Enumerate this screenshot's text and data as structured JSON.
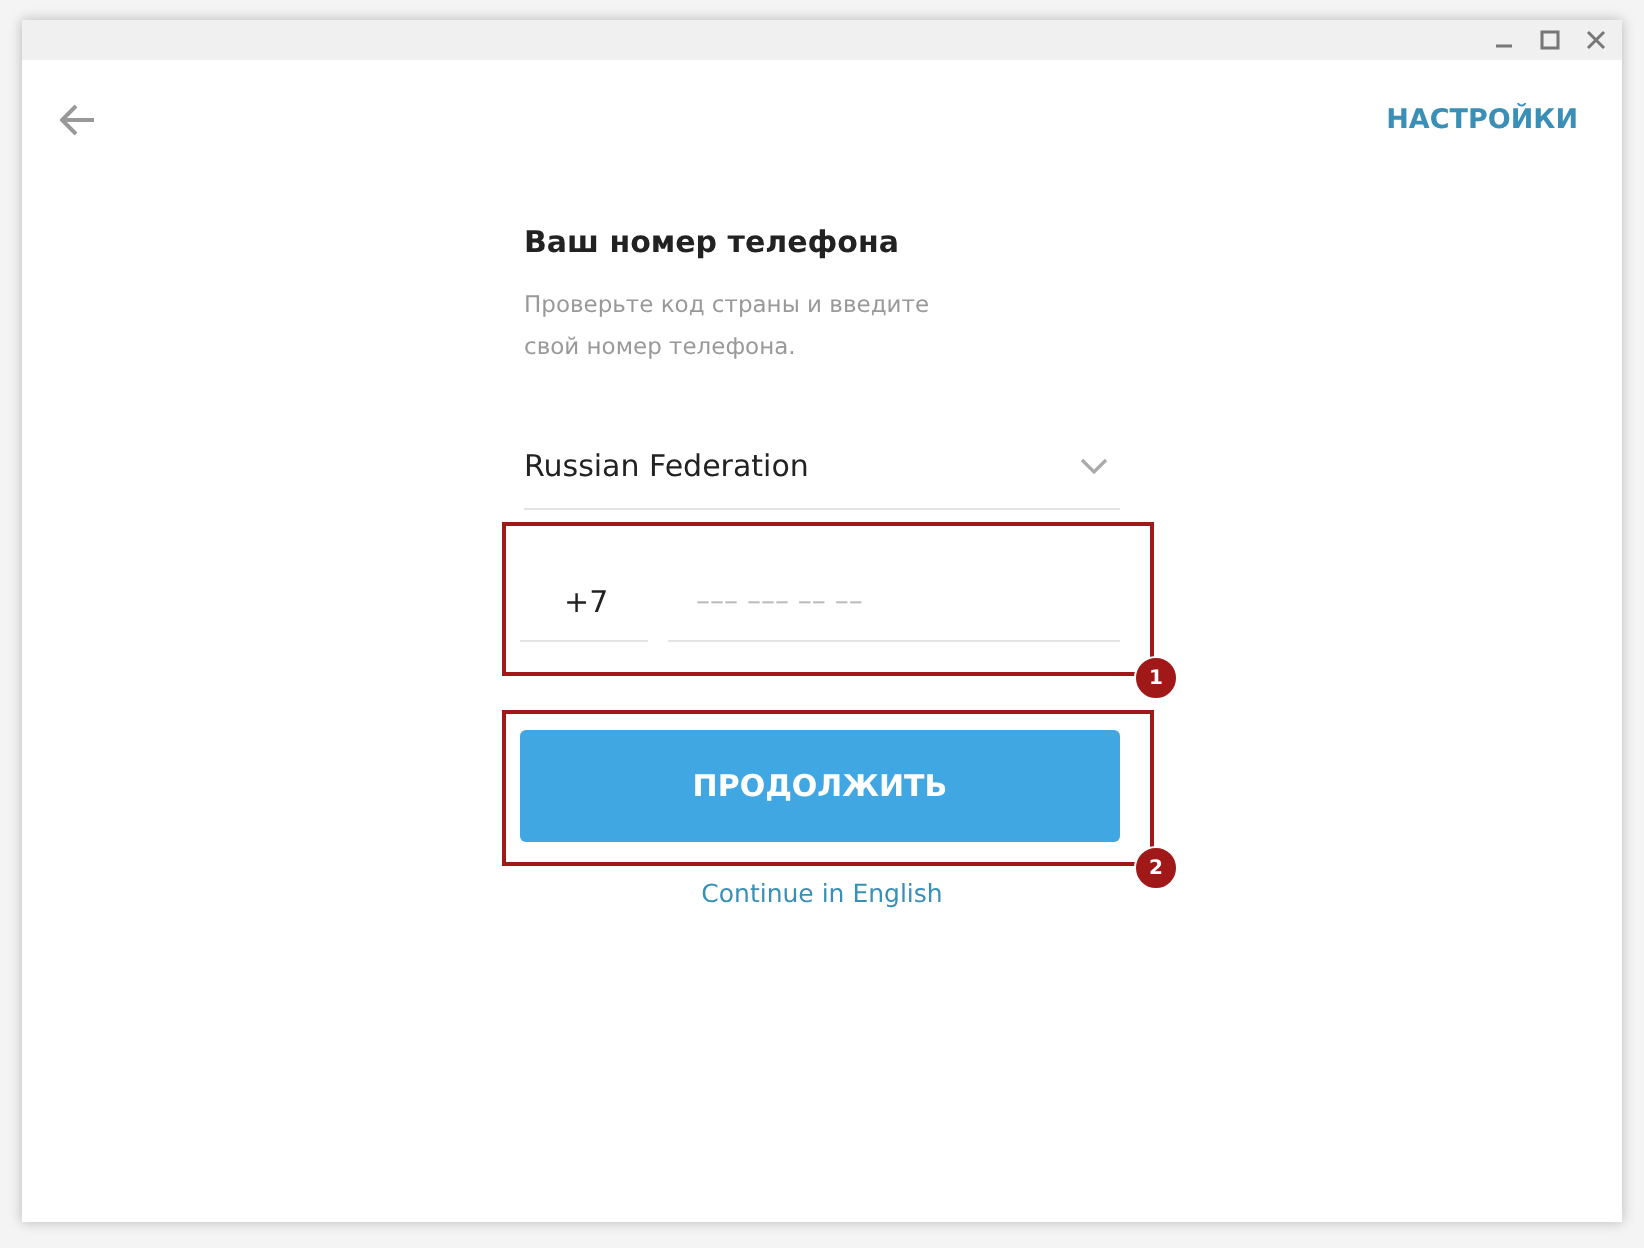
{
  "header": {
    "settings_link": "НАСТРОЙКИ"
  },
  "form": {
    "title": "Ваш номер телефона",
    "subtitle": "Проверьте код страны и введите свой номер телефона.",
    "country": "Russian Federation",
    "country_code": "+7",
    "phone_placeholder": "––– ––– –– ––",
    "continue_button": "ПРОДОЛЖИТЬ",
    "english_link": "Continue in English"
  },
  "annotations": [
    {
      "label": "1"
    },
    {
      "label": "2"
    }
  ]
}
